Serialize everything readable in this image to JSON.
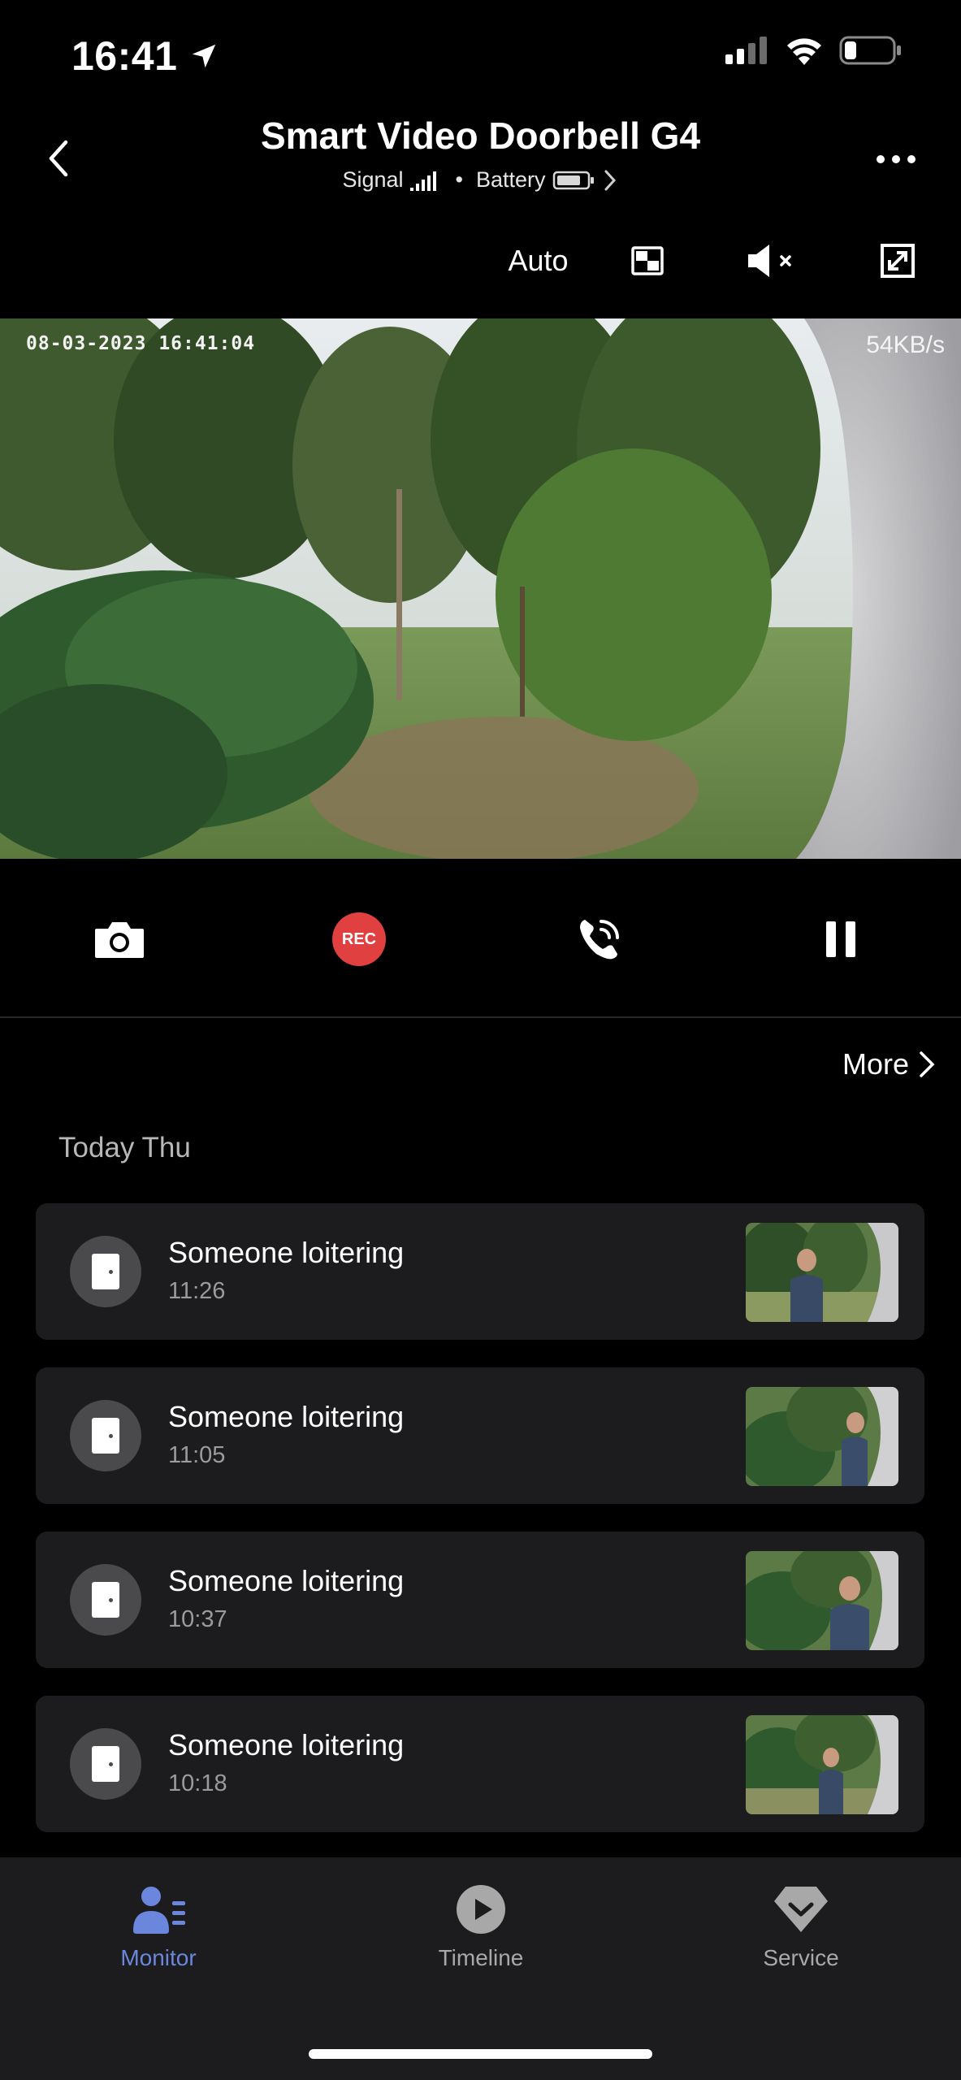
{
  "status_bar": {
    "time": "16:41"
  },
  "header": {
    "title": "Smart Video Doorbell G4",
    "signal_label": "Signal",
    "separator": "•",
    "battery_label": "Battery"
  },
  "controls": {
    "quality": "Auto"
  },
  "video": {
    "timestamp": "08-03-2023 16:41:04",
    "bitrate": "54KB/s"
  },
  "actions": {
    "rec_label": "REC"
  },
  "events_section": {
    "more_label": "More",
    "day_label": "Today Thu",
    "items": [
      {
        "title": "Someone loitering",
        "time": "11:26"
      },
      {
        "title": "Someone loitering",
        "time": "11:05"
      },
      {
        "title": "Someone loitering",
        "time": "10:37"
      },
      {
        "title": "Someone loitering",
        "time": "10:18"
      }
    ]
  },
  "tabbar": {
    "tabs": [
      {
        "label": "Monitor",
        "active": true
      },
      {
        "label": "Timeline",
        "active": false
      },
      {
        "label": "Service",
        "active": false
      }
    ],
    "active_color": "#6b87dd"
  },
  "colors": {
    "rec": "#e04040",
    "card_bg": "#1c1c1e"
  }
}
